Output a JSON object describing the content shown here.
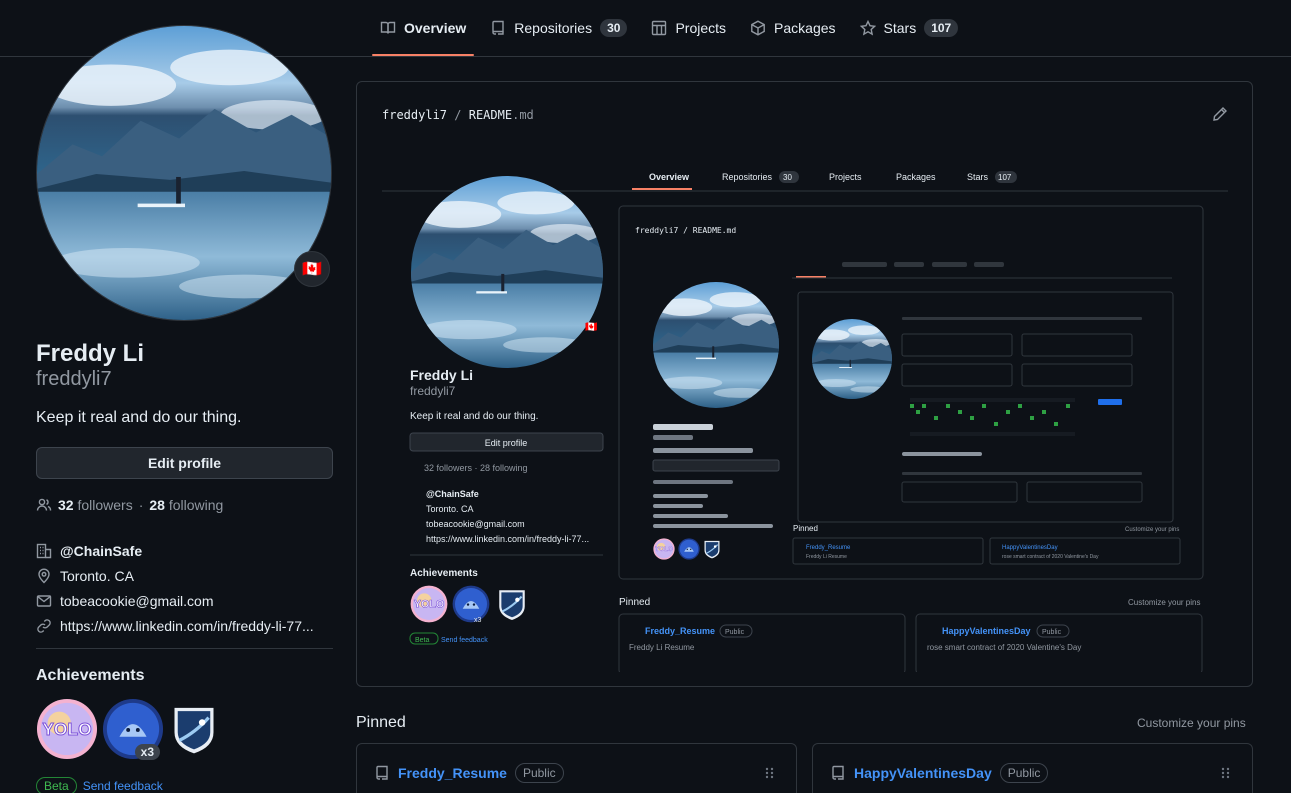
{
  "nav": {
    "tabs": [
      {
        "label": "Overview",
        "count": null
      },
      {
        "label": "Repositories",
        "count": "30"
      },
      {
        "label": "Projects",
        "count": null
      },
      {
        "label": "Packages",
        "count": null
      },
      {
        "label": "Stars",
        "count": "107"
      }
    ]
  },
  "profile": {
    "name": "Freddy Li",
    "login": "freddyli7",
    "bio": "Keep it real and do our thing.",
    "edit_label": "Edit profile",
    "followers": "32",
    "followers_label": "followers",
    "separator": "·",
    "following": "28",
    "following_label": "following",
    "org": "@ChainSafe",
    "location": "Toronto. CA",
    "email": "tobeacookie@gmail.com",
    "website": "https://www.linkedin.com/in/freddy-li-77...",
    "flag": "🇨🇦"
  },
  "achievements": {
    "title": "Achievements",
    "badges": [
      {
        "icon": "yolo-badge-icon",
        "count": null
      },
      {
        "icon": "pull-shark-badge-icon",
        "count": "x3"
      },
      {
        "icon": "arctic-code-vault-badge-icon",
        "count": null
      }
    ],
    "beta_label": "Beta",
    "feedback_label": "Send feedback"
  },
  "readme": {
    "owner": "freddyli7",
    "separator": "/",
    "file": "README",
    "ext": ".md"
  },
  "nested": {
    "tabs": [
      "Overview",
      "Repositories",
      "Projects",
      "Packages",
      "Stars"
    ],
    "repos_count": "30",
    "stars_count": "107",
    "readme_path": "freddyli7 / README.md",
    "name": "Freddy Li",
    "login": "freddyli7",
    "bio": "Keep it real and do our thing.",
    "edit_label": "Edit profile",
    "follow_line": "32 followers · 28 following",
    "org": "@ChainSafe",
    "location": "Toronto. CA",
    "email": "tobeacookie@gmail.com",
    "website": "https://www.linkedin.com/in/freddy-li-77...",
    "achievements": "Achievements",
    "x3": "x3",
    "beta": "Beta",
    "feedback": "Send feedback",
    "pinned": "Pinned",
    "customize": "Customize your pins",
    "pin1_name": "Freddy_Resume",
    "pin1_desc": "Freddy Li Resume",
    "pin2_name": "HappyValentinesDay",
    "pin2_desc": "rose smart contract of 2020 Valentine's Day",
    "public": "Public"
  },
  "pinned": {
    "title": "Pinned",
    "customize_label": "Customize your pins",
    "items": [
      {
        "name": "Freddy_Resume",
        "visibility": "Public"
      },
      {
        "name": "HappyValentinesDay",
        "visibility": "Public"
      }
    ]
  },
  "colors": {
    "bg": "#0d1117",
    "border": "#30363d",
    "accent": "#f78166",
    "link": "#4493f8",
    "muted": "#9198a1"
  }
}
